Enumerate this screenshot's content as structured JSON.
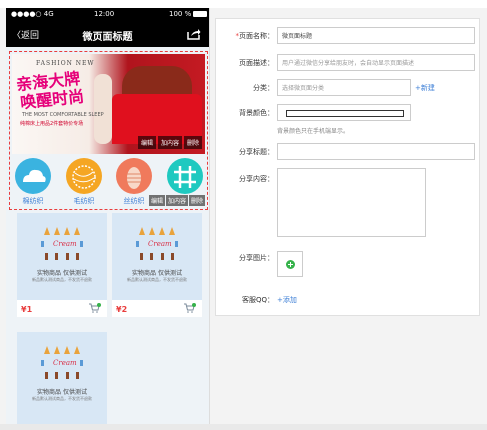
{
  "phone": {
    "status": {
      "carrier": "●●●●○ 4G",
      "time": "12:00",
      "battery": "100 %"
    },
    "nav": {
      "back_label": "〈返回",
      "title": "微页面标题",
      "share_icon": "share-icon"
    },
    "banner": {
      "tagline": "FASHION NEW",
      "headline_1": "亲海大牌",
      "headline_2": "唤醒时尚",
      "subline_1": "THE MOST COMFORTABLE SLEEP",
      "subline_2": "纯棉床上用品2件套特价专场",
      "actions": [
        "编辑",
        "加内容",
        "删除"
      ]
    },
    "nav_icons": [
      {
        "label": "棉纺织",
        "color": "#3ab3e0"
      },
      {
        "label": "毛纺织",
        "color": "#f5a623"
      },
      {
        "label": "丝纺织",
        "color": "#f07a5c"
      },
      {
        "label": "",
        "color": "#1fc9c0"
      }
    ],
    "nav_actions": [
      "编辑",
      "加内容",
      "删除"
    ],
    "products": [
      {
        "name": "实物商品 仅供测试",
        "desc": "新品默认测试商品，不发货不退款",
        "price": "¥1"
      },
      {
        "name": "实物商品 仅供测试",
        "desc": "新品默认测试商品，不发货不退款",
        "price": "¥2"
      },
      {
        "name": "实物商品 仅供测试",
        "desc": "新品默认测试商品，不发货不退款",
        "price": ""
      }
    ]
  },
  "form": {
    "page_name": {
      "label": "页面名称：",
      "value": "微页面标题"
    },
    "page_desc": {
      "label": "页面描述：",
      "placeholder": "用户通过微信分享给朋友时，会自动显示页面描述"
    },
    "category": {
      "label": "分类：",
      "placeholder": "选择微页面分类",
      "link": "+新建"
    },
    "bg_color": {
      "label": "背景颜色：",
      "hint": "背景颜色只在手机端显示。"
    },
    "share_title": {
      "label": "分享标题："
    },
    "share_content": {
      "label": "分享内容："
    },
    "share_image": {
      "label": "分享图片："
    },
    "service_qq": {
      "label": "客服QQ：",
      "link": "+添加"
    }
  }
}
